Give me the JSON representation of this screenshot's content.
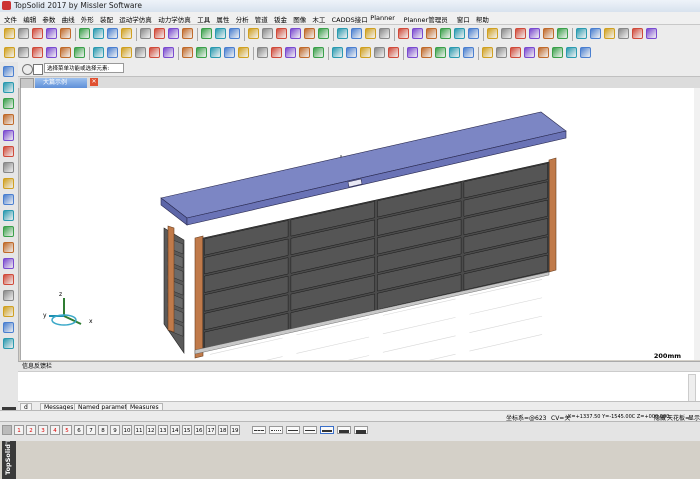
{
  "window": {
    "title": "TopSolid 2017 by Missler Software"
  },
  "menu": [
    "文件",
    "编辑",
    "参数",
    "曲线",
    "外形",
    "装配",
    "运动学仿真",
    "动力学仿真",
    "工具",
    "属性",
    "分析",
    "管道",
    "钣金",
    "图像",
    "木工",
    "CADDS接口",
    "Planner",
    "Planner管理员",
    "窗口",
    "帮助"
  ],
  "selection": {
    "prompt": "选择菜单功能或选择元素:"
  },
  "document": {
    "tab_label": "大篇示例",
    "close_glyph": "✕"
  },
  "viewport": {
    "scale_label": "200mm",
    "axis_x": "x",
    "axis_y": "y",
    "axis_z": "z"
  },
  "messages": {
    "header": "信息反馈栏",
    "tabs": [
      "Messages",
      "Named parameters",
      "Measures"
    ],
    "left_tab": "d"
  },
  "status": {
    "csys": "坐标系=@623",
    "cv": "CV=关",
    "coords": "X=+1337.50  Y=-1545.00C  Z=+000.000",
    "hidden": "隐藏",
    "snap": "天花板=",
    "display": "显示"
  },
  "layers": [
    "1",
    "2",
    "3",
    "4",
    "5",
    "6",
    "7",
    "8",
    "9",
    "10",
    "11",
    "12",
    "13",
    "14",
    "15",
    "16",
    "17",
    "18",
    "19"
  ],
  "red_layers": 5,
  "brand": {
    "text": "TopSolid'Design"
  },
  "colors": {
    "top": "#7c86c4",
    "drawer": "#4b4b4b",
    "frame": "#c07a4a",
    "accent": "#5f90d8"
  }
}
